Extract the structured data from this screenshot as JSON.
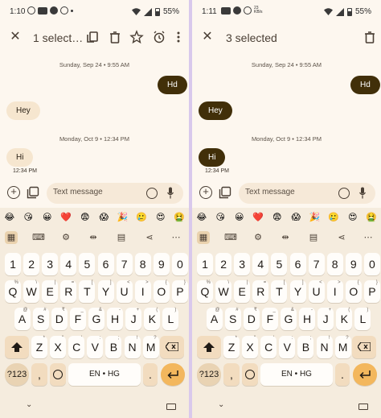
{
  "left": {
    "status": {
      "time": "1:10",
      "battery": "55%"
    },
    "appbar": {
      "title": "1 select…"
    },
    "thread": {
      "date1": "Sunday, Sep 24 • 9:55 AM",
      "msg_out": "Hd",
      "msg_in1": "Hey",
      "date2": "Monday, Oct 9 • 12:34 PM",
      "msg_in2": "Hi",
      "msg_in2_time": "12:34 PM"
    },
    "composer": {
      "placeholder": "Text message"
    }
  },
  "right": {
    "status": {
      "time": "1:11",
      "signal_label": "23\nKB/s",
      "battery": "55%"
    },
    "appbar": {
      "title": "3 selected"
    },
    "thread": {
      "date1": "Sunday, Sep 24 • 9:55 AM",
      "msg_out": "Hd",
      "msg_in1": "Hey",
      "date2": "Monday, Oct 9 • 12:34 PM",
      "msg_in2": "Hi",
      "msg_in2_time": "12:34 PM"
    },
    "composer": {
      "placeholder": "Text message"
    }
  },
  "keyboard": {
    "emojis": [
      "😂",
      "😘",
      "😀",
      "❤️",
      "😨",
      "😱",
      "🎉",
      "🥲",
      "😍",
      "🤮"
    ],
    "numbers": [
      "1",
      "2",
      "3",
      "4",
      "5",
      "6",
      "7",
      "8",
      "9",
      "0"
    ],
    "row1": [
      "Q",
      "W",
      "E",
      "R",
      "T",
      "Y",
      "U",
      "I",
      "O",
      "P"
    ],
    "row1_hints": [
      "%",
      "\\",
      "|",
      "=",
      "[",
      "]",
      "<",
      ">",
      "{",
      "}"
    ],
    "row2": [
      "A",
      "S",
      "D",
      "F",
      "G",
      "H",
      "J",
      "K",
      "L"
    ],
    "row2_hints": [
      "@",
      "#",
      "₹",
      "_",
      "&",
      "-",
      "+",
      "(",
      ")"
    ],
    "row3": [
      "Z",
      "X",
      "C",
      "V",
      "B",
      "N",
      "M"
    ],
    "row3_hints": [
      "*",
      "\"",
      "'",
      ":",
      ";",
      "!",
      "?"
    ],
    "symbols_key": "?123",
    "comma_key": ",",
    "space_key": "EN • HG",
    "period_key": "."
  },
  "colors": {
    "background": "#fdf7ef",
    "bubble_outgoing": "#412f09",
    "bubble_incoming": "#f6e6cf",
    "enter_key": "#f3b75d",
    "divider": "#d9c9ec"
  }
}
